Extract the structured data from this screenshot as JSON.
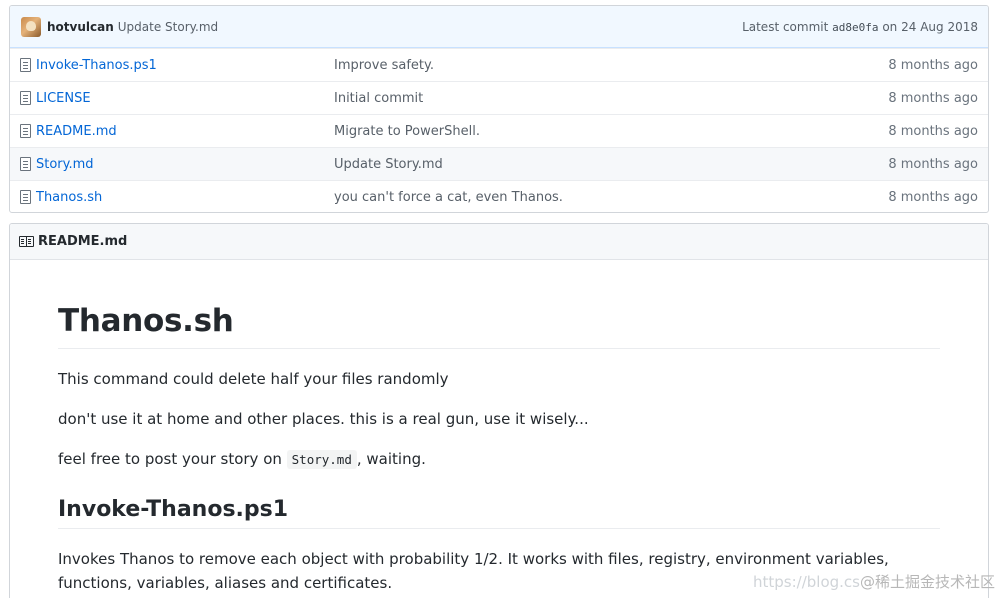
{
  "commit_bar": {
    "author": "hotvulcan",
    "message": "Update Story.md",
    "latest_label": "Latest commit",
    "sha": "ad8e0fa",
    "date_prefix": "on",
    "date": "24 Aug 2018"
  },
  "files": [
    {
      "name": "Invoke-Thanos.ps1",
      "commit": "Improve safety.",
      "age": "8 months ago"
    },
    {
      "name": "LICENSE",
      "commit": "Initial commit",
      "age": "8 months ago"
    },
    {
      "name": "README.md",
      "commit": "Migrate to PowerShell.",
      "age": "8 months ago"
    },
    {
      "name": "Story.md",
      "commit": "Update Story.md",
      "age": "8 months ago"
    },
    {
      "name": "Thanos.sh",
      "commit": "you can't force a cat, even Thanos.",
      "age": "8 months ago"
    }
  ],
  "readme": {
    "header": "README.md",
    "title": "Thanos.sh",
    "p1": "This command could delete half your files randomly",
    "p2": "don't use it at home and other places. this is a real gun, use it wisely...",
    "p3_before": "feel free to post your story on ",
    "p3_code": "Story.md",
    "p3_after": ", waiting.",
    "h2": "Invoke-Thanos.ps1",
    "p4": "Invokes Thanos to remove each object with probability 1/2. It works with files, registry, environment variables, functions, variables, aliases and certificates."
  },
  "watermark": {
    "url": "https://blog.cs",
    "text": "@稀土掘金技术社区"
  }
}
